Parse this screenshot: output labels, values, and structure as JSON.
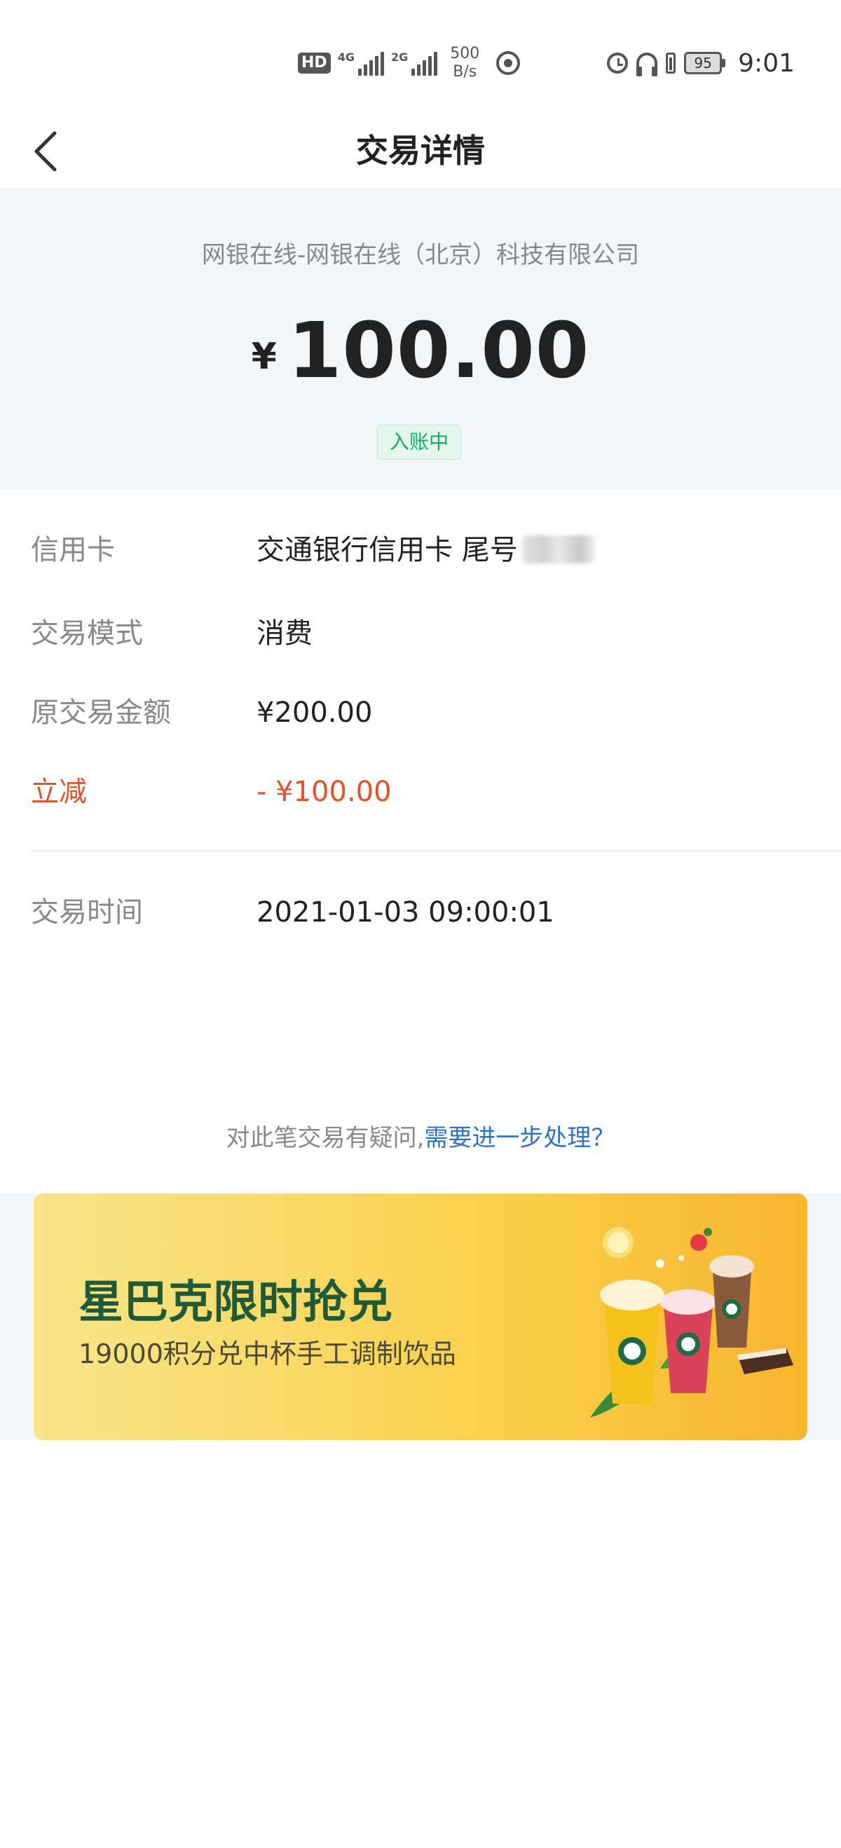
{
  "status_bar": {
    "hd_label": "HD",
    "net_tag_1": "4G",
    "net_tag_2": "2G",
    "speed_value": "500",
    "speed_unit": "B/s",
    "battery_level": "95",
    "time": "9:01"
  },
  "title_bar": {
    "title": "交易详情"
  },
  "summary": {
    "merchant": "网银在线-网银在线（北京）科技有限公司",
    "currency_symbol": "¥",
    "amount": "100.00",
    "status": "入账中"
  },
  "details": [
    {
      "label": "信用卡",
      "value": "交通银行信用卡 尾号"
    },
    {
      "label": "交易模式",
      "value": "消费"
    },
    {
      "label": "原交易金额",
      "value": "¥200.00"
    },
    {
      "label": "立减",
      "value": "- ¥100.00"
    },
    {
      "label": "交易时间",
      "value": "2021-01-03 09:00:01"
    }
  ],
  "help": {
    "question": "对此笔交易有疑问,",
    "link": "需要进一步处理？"
  },
  "banner": {
    "title": "星巴克限时抢兑",
    "subtitle": "19000积分兑中杯手工调制饮品"
  },
  "colors": {
    "accent_red": "#e0532b",
    "status_green": "#1ba86a",
    "link_blue": "#2e73c9",
    "brand_green": "#1f5b3a"
  }
}
